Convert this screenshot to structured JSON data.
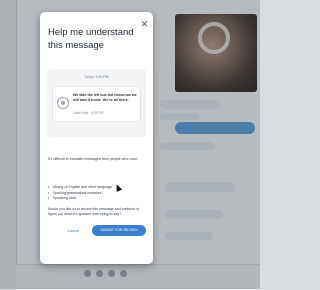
{
  "dialog": {
    "title": "Help me understand this message",
    "close_icon": "close-icon",
    "conversation": {
      "date": "Today, 6:26 PM",
      "voice_message_text": "We take the left bus but tomorrow we will take it home. We've all there.",
      "voice_message_meta": "Voice Note · 6:26 PM"
    },
    "intro_text": "It's difficult to translate messages from people who have:",
    "reasons": [
      "Mixing of English and other language",
      "Spelling/grammatical mistakes",
      "Speaking slow"
    ],
    "question_text": "Would you like us to review this message and continue to figure out what the speaker was trying to say?",
    "cancel_label": "Cancel",
    "submit_label": "SUBMIT FOR REVIEW"
  },
  "colors": {
    "accent": "#3b7fd0",
    "overlay": "#282d37"
  }
}
